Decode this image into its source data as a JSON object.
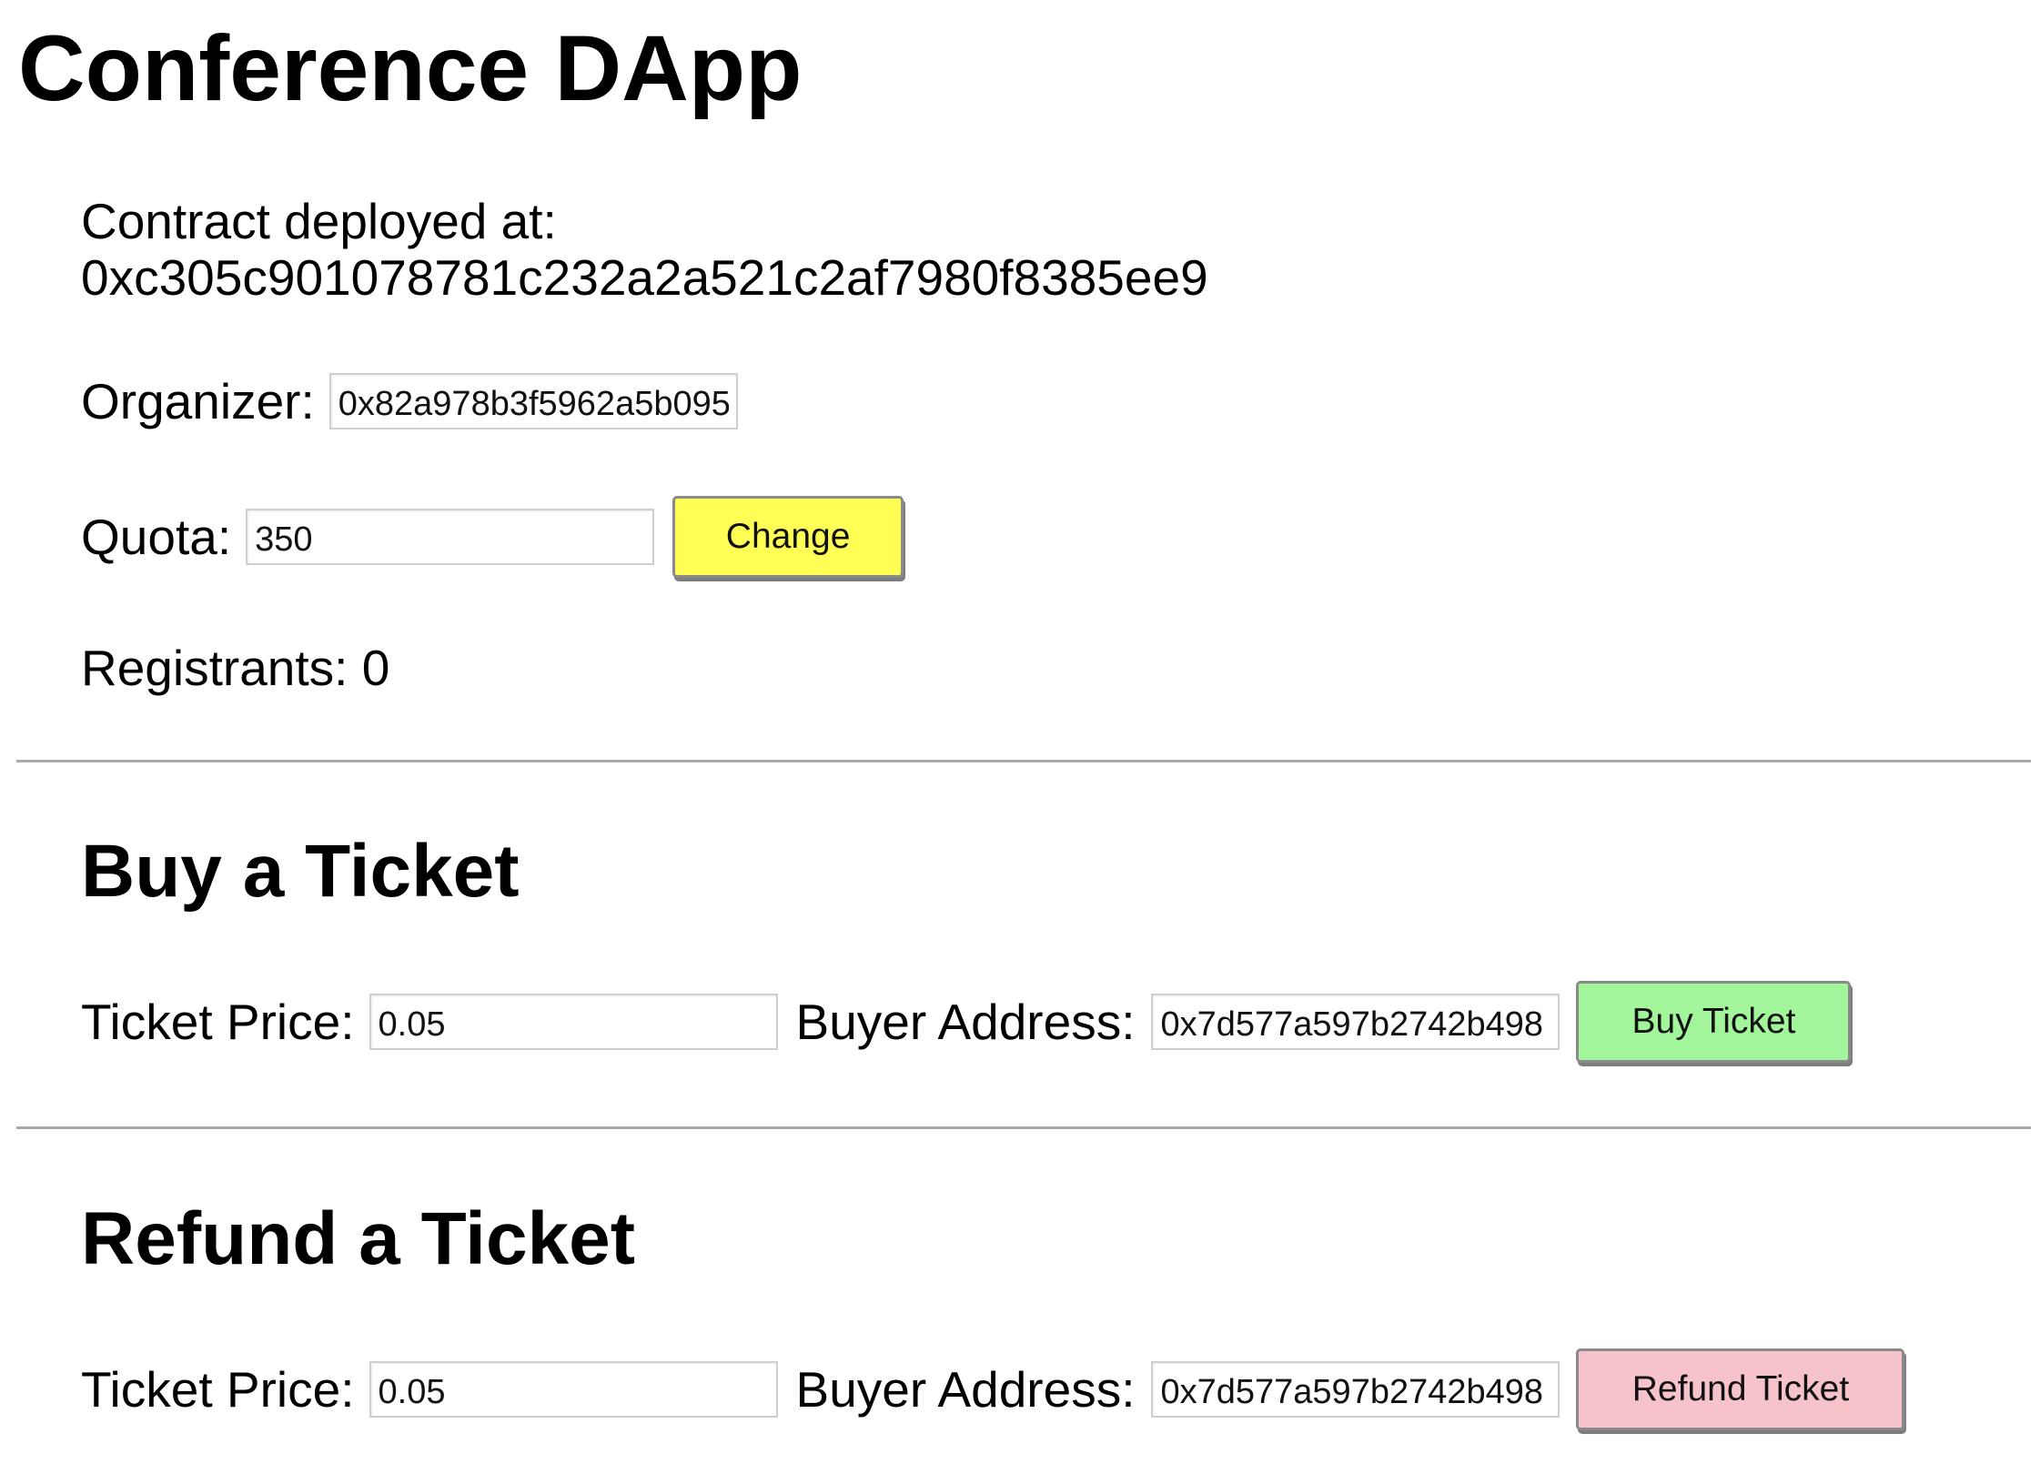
{
  "page": {
    "title": "Conference DApp"
  },
  "contract": {
    "label": "Contract deployed at:",
    "address": "0xc305c901078781c232a2a521c2af7980f8385ee9"
  },
  "organizer": {
    "label": "Organizer:",
    "value": "0x82a978b3f5962a5b095"
  },
  "quota": {
    "label": "Quota:",
    "value": "350",
    "change_label": "Change"
  },
  "registrants": {
    "label": "Registrants: 0"
  },
  "buy": {
    "heading": "Buy a Ticket",
    "price_label": "Ticket Price:",
    "price_value": "0.05",
    "address_label": "Buyer Address:",
    "address_value": "0x7d577a597b2742b498",
    "button_label": "Buy Ticket"
  },
  "refund": {
    "heading": "Refund a Ticket",
    "price_label": "Ticket Price:",
    "price_value": "0.05",
    "address_label": "Buyer Address:",
    "address_value": "0x7d577a597b2742b498",
    "button_label": "Refund Ticket"
  },
  "colors": {
    "change_button": "#ffff55",
    "buy_button": "#a2f59a",
    "refund_button": "#f6c3cb",
    "divider": "#a9a9a9"
  }
}
